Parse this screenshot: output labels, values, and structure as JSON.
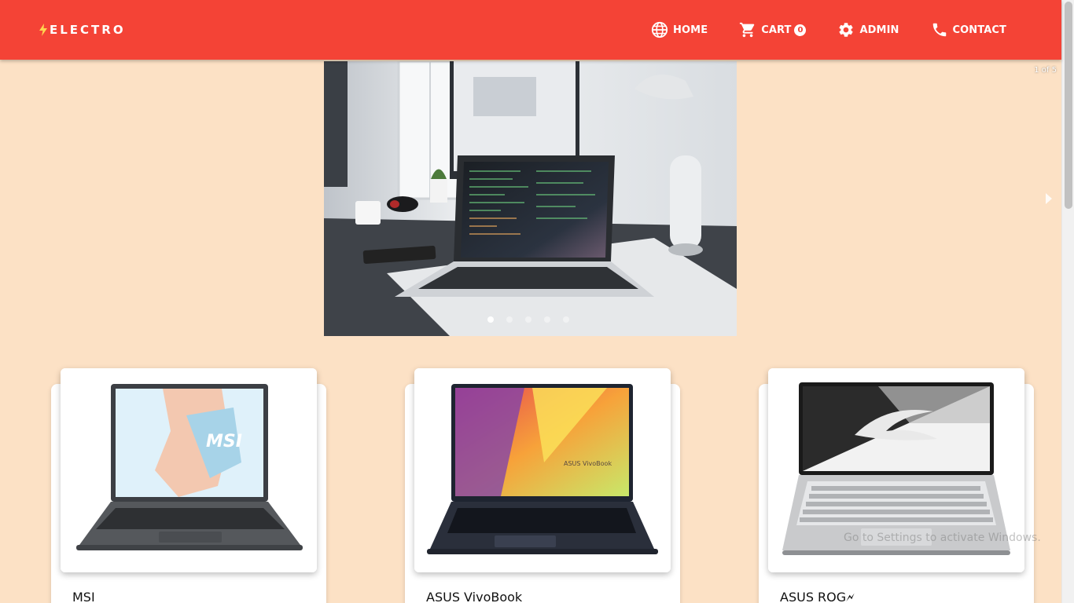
{
  "brand": {
    "name": "ELECTRO",
    "icon": "bolt-icon"
  },
  "nav": {
    "items": [
      {
        "label": "HOME",
        "icon": "globe-icon"
      },
      {
        "label": "CART",
        "icon": "cart-icon",
        "badge": "0"
      },
      {
        "label": "ADMIN",
        "icon": "gear-icon"
      },
      {
        "label": "CONTACT",
        "icon": "phone-icon"
      }
    ]
  },
  "carousel": {
    "position_text": "1 of 5",
    "slide_count": 5,
    "active_index": 0
  },
  "products": [
    {
      "name": "MSI"
    },
    {
      "name": "ASUS VivoBook"
    },
    {
      "name": "ASUS ROG🗲"
    }
  ],
  "watermark": "Go to Settings to activate Windows.",
  "colors": {
    "header": "#f44336",
    "background": "#fce1c5"
  }
}
